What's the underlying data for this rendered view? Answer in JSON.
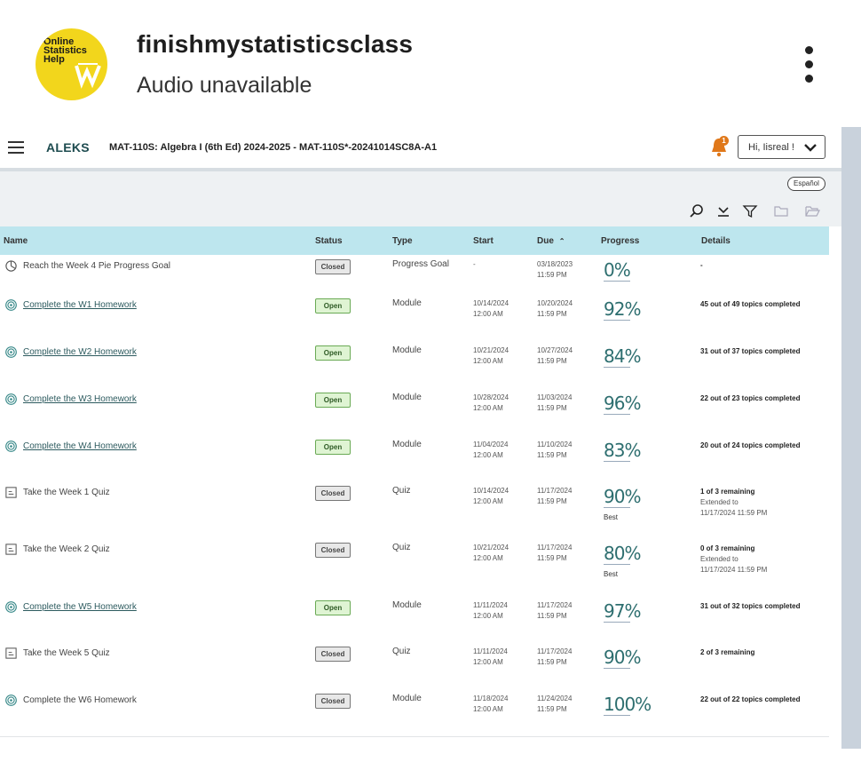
{
  "post": {
    "account_name": "finishmystatisticsclass",
    "subtitle": "Audio unavailable",
    "avatar_text": [
      "Online",
      "Statistics",
      "Help"
    ]
  },
  "aleks": {
    "logo": "ALEKS",
    "course_title": "MAT-110S: Algebra I (6th Ed) 2024-2025 - MAT-110S*-20241014SC8A-A1",
    "notification_count": "1",
    "user_greeting": "Hi, Iisreal !",
    "espanol_label": "Español",
    "columns": {
      "name": "Name",
      "status": "Status",
      "type": "Type",
      "start": "Start",
      "due": "Due",
      "progress": "Progress",
      "details": "Details"
    },
    "rows": [
      {
        "icon": "pie-goal",
        "name": "Reach the Week 4 Pie Progress Goal",
        "link": false,
        "status": "Closed",
        "type": "Progress Goal",
        "start": "-",
        "start_time": "",
        "due": "03/18/2023",
        "due_time": "11:59 PM",
        "progress": "0%",
        "best": "",
        "details": "-",
        "details_sub": ""
      },
      {
        "icon": "module",
        "name": "Complete the W1 Homework",
        "link": true,
        "status": "Open",
        "type": "Module",
        "start": "10/14/2024",
        "start_time": "12:00 AM",
        "due": "10/20/2024",
        "due_time": "11:59 PM",
        "progress": "92%",
        "best": "",
        "details": "45 out of 49 topics completed",
        "details_sub": ""
      },
      {
        "icon": "module",
        "name": "Complete the W2 Homework",
        "link": true,
        "status": "Open",
        "type": "Module",
        "start": "10/21/2024",
        "start_time": "12:00 AM",
        "due": "10/27/2024",
        "due_time": "11:59 PM",
        "progress": "84%",
        "best": "",
        "details": "31 out of 37 topics completed",
        "details_sub": ""
      },
      {
        "icon": "module",
        "name": "Complete the W3 Homework",
        "link": true,
        "status": "Open",
        "type": "Module",
        "start": "10/28/2024",
        "start_time": "12:00 AM",
        "due": "11/03/2024",
        "due_time": "11:59 PM",
        "progress": "96%",
        "best": "",
        "details": "22 out of 23 topics completed",
        "details_sub": ""
      },
      {
        "icon": "module",
        "name": "Complete the W4 Homework",
        "link": true,
        "status": "Open",
        "type": "Module",
        "start": "11/04/2024",
        "start_time": "12:00 AM",
        "due": "11/10/2024",
        "due_time": "11:59 PM",
        "progress": "83%",
        "best": "",
        "details": "20 out of 24 topics completed",
        "details_sub": ""
      },
      {
        "icon": "quiz",
        "name": "Take the Week 1 Quiz",
        "link": false,
        "status": "Closed",
        "type": "Quiz",
        "start": "10/14/2024",
        "start_time": "12:00 AM",
        "due": "11/17/2024",
        "due_time": "11:59 PM",
        "progress": "90%",
        "best": "Best",
        "details": "1 of 3 remaining",
        "details_sub": "Extended to|11/17/2024 11:59 PM"
      },
      {
        "icon": "quiz",
        "name": "Take the Week 2 Quiz",
        "link": false,
        "status": "Closed",
        "type": "Quiz",
        "start": "10/21/2024",
        "start_time": "12:00 AM",
        "due": "11/17/2024",
        "due_time": "11:59 PM",
        "progress": "80%",
        "best": "Best",
        "details": "0 of 3 remaining",
        "details_sub": "Extended to|11/17/2024 11:59 PM"
      },
      {
        "icon": "module",
        "name": "Complete the W5 Homework",
        "link": true,
        "status": "Open",
        "type": "Module",
        "start": "11/11/2024",
        "start_time": "12:00 AM",
        "due": "11/17/2024",
        "due_time": "11:59 PM",
        "progress": "97%",
        "best": "",
        "details": "31 out of 32 topics completed",
        "details_sub": ""
      },
      {
        "icon": "quiz",
        "name": "Take the Week 5 Quiz",
        "link": false,
        "status": "Closed",
        "type": "Quiz",
        "start": "11/11/2024",
        "start_time": "12:00 AM",
        "due": "11/17/2024",
        "due_time": "11:59 PM",
        "progress": "90%",
        "best": "",
        "details": "2 of 3 remaining",
        "details_sub": ""
      },
      {
        "icon": "module",
        "name": "Complete the W6 Homework",
        "link": false,
        "status": "Closed",
        "type": "Module",
        "start": "11/18/2024",
        "start_time": "12:00 AM",
        "due": "11/24/2024",
        "due_time": "11:59 PM",
        "progress": "100%",
        "best": "",
        "details": "22 out of 22 topics completed",
        "details_sub": ""
      }
    ]
  },
  "colors": {
    "header_row": "#bde6ee",
    "open_badge": "#dff4d3",
    "closed_badge": "#e8e8e8",
    "progress_text": "#2d6e6f",
    "notification": "#e0781a"
  }
}
